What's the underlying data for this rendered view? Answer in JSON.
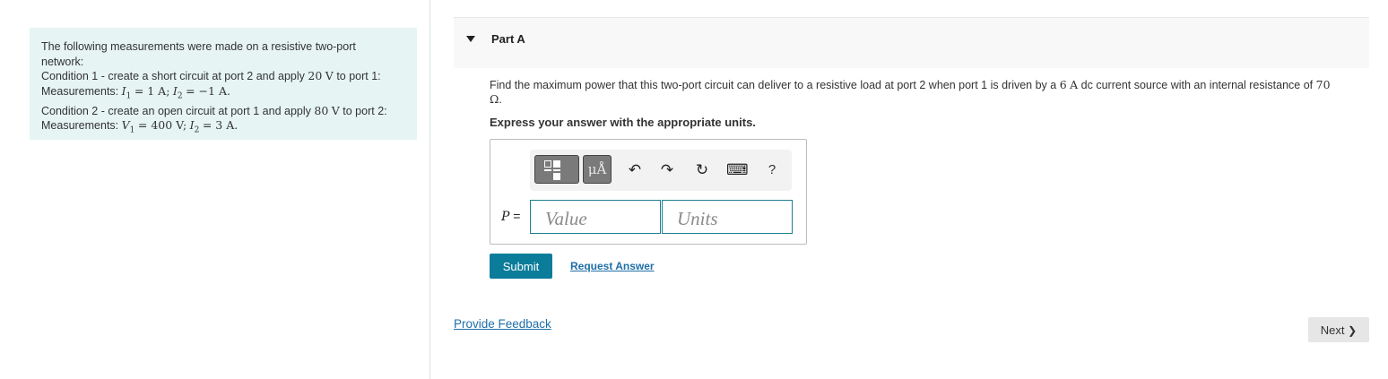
{
  "info": {
    "intro": "The following measurements were made on a resistive two-port network:",
    "condition1": {
      "prefix": "Condition 1 - create a short circuit at port 2 and apply",
      "value": "20",
      "unit": "V",
      "suffix": "to port 1:"
    },
    "measurements1": {
      "label": "Measurements:",
      "var1": "I",
      "sub1": "1",
      "val1": "= 1 A",
      "sep": ";",
      "var2": "I",
      "sub2": "2",
      "val2": "= −1 A",
      "end": "."
    },
    "condition2": {
      "prefix": "Condition 2 - create an open circuit at port 1 and apply",
      "value": "80",
      "unit": "V",
      "suffix": "to port 2:"
    },
    "measurements2": {
      "label": "Measurements:",
      "var1": "V",
      "sub1": "1",
      "val1": "= 400 V",
      "sep": ";",
      "var2": "I",
      "sub2": "2",
      "val2": "= 3 A",
      "end": "."
    }
  },
  "part": {
    "title": "Part A",
    "question_before": "Find the maximum power that this two-port circuit can deliver to a resistive load at port 2 when port 1 is driven by a",
    "current_value": "6",
    "current_unit": "A",
    "question_after": "dc current source with an internal resistance of",
    "resistance_value": "70",
    "resistance_unit": "Ω",
    "question_end": ".",
    "instruction": "Express your answer with the appropriate units."
  },
  "toolbar": {
    "units_label": "μÅ",
    "undo_icon": "↶",
    "redo_icon": "↷",
    "reset_icon": "↻",
    "keyboard_icon": "⌨",
    "help_label": "?"
  },
  "answer": {
    "variable": "P",
    "equals": " =",
    "value_placeholder": "Value",
    "units_placeholder": "Units"
  },
  "actions": {
    "submit_label": "Submit",
    "request_answer_label": "Request Answer",
    "provide_feedback_label": "Provide Feedback",
    "next_label": "Next",
    "next_icon": "❯"
  }
}
